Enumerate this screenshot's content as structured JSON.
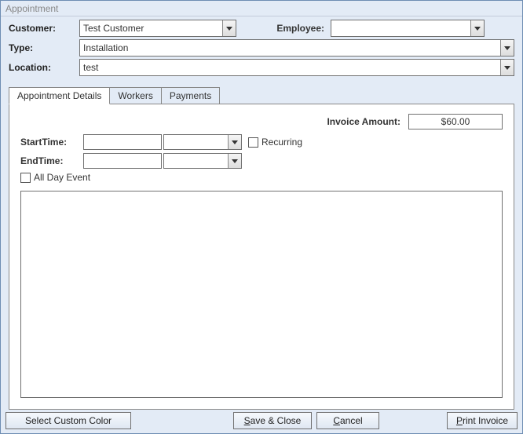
{
  "window": {
    "title": "Appointment"
  },
  "fields": {
    "customer": {
      "label": "Customer:",
      "value": "Test Customer"
    },
    "employee": {
      "label": "Employee:",
      "value": ""
    },
    "type": {
      "label": "Type:",
      "value": "Installation"
    },
    "location": {
      "label": "Location:",
      "value": "test"
    }
  },
  "tabs": {
    "details": "Appointment Details",
    "workers": "Workers",
    "payments": "Payments"
  },
  "details": {
    "invoice_label": "Invoice Amount:",
    "invoice_value": "$60.00",
    "starttime_label": "StartTime:",
    "endtime_label": "EndTime:",
    "recurring_label": "Recurring",
    "alldayevent_label": "All Day Event",
    "starttime_date": "",
    "starttime_time": "",
    "endtime_date": "",
    "endtime_time": ""
  },
  "buttons": {
    "select_color": "Select Custom Color",
    "save_close": "Save & Close",
    "cancel": "Cancel",
    "print_invoice": "Print Invoice"
  }
}
